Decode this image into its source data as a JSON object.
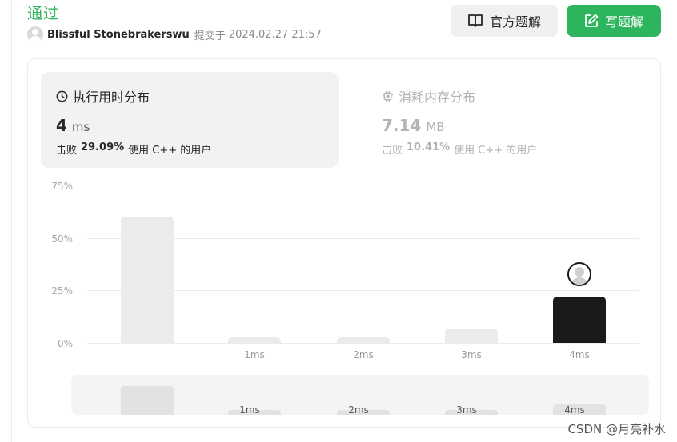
{
  "result": {
    "status": "通过"
  },
  "submission": {
    "user": "Blissful Stonebrakerswu",
    "submit_label": "提交于",
    "time": "2024.02.27 21:57"
  },
  "actions": {
    "official_solution": "官方题解",
    "write_solution": "写题解"
  },
  "runtime": {
    "title": "执行用时分布",
    "value": "4",
    "unit": "ms",
    "beat_prefix": "击败",
    "beat_pct": "29.09%",
    "beat_suffix": "使用 C++ 的用户"
  },
  "memory": {
    "title": "消耗内存分布",
    "value": "7.14",
    "unit": "MB",
    "beat_prefix": "击败",
    "beat_pct": "10.41%",
    "beat_suffix": "使用 C++ 的用户"
  },
  "chart_data": {
    "type": "bar",
    "categories": [
      "",
      "1ms",
      "2ms",
      "3ms",
      "4ms"
    ],
    "values": [
      60,
      2.5,
      2.5,
      7,
      22
    ],
    "ylim": [
      0,
      75
    ],
    "yticks": [
      "75%",
      "50%",
      "25%",
      "0%"
    ],
    "highlight_index": 4,
    "grid": true
  },
  "brush": {
    "labels": [
      "",
      "1ms",
      "2ms",
      "3ms",
      "4ms"
    ]
  },
  "watermark": "CSDN @月亮补水",
  "colors": {
    "accent": "#2db55d",
    "bar": "#ebebeb",
    "highlight_bar": "#1a1a1a"
  },
  "icons": {
    "book": "book-icon",
    "edit": "edit-icon",
    "clock": "clock-icon",
    "chip": "chip-icon"
  }
}
